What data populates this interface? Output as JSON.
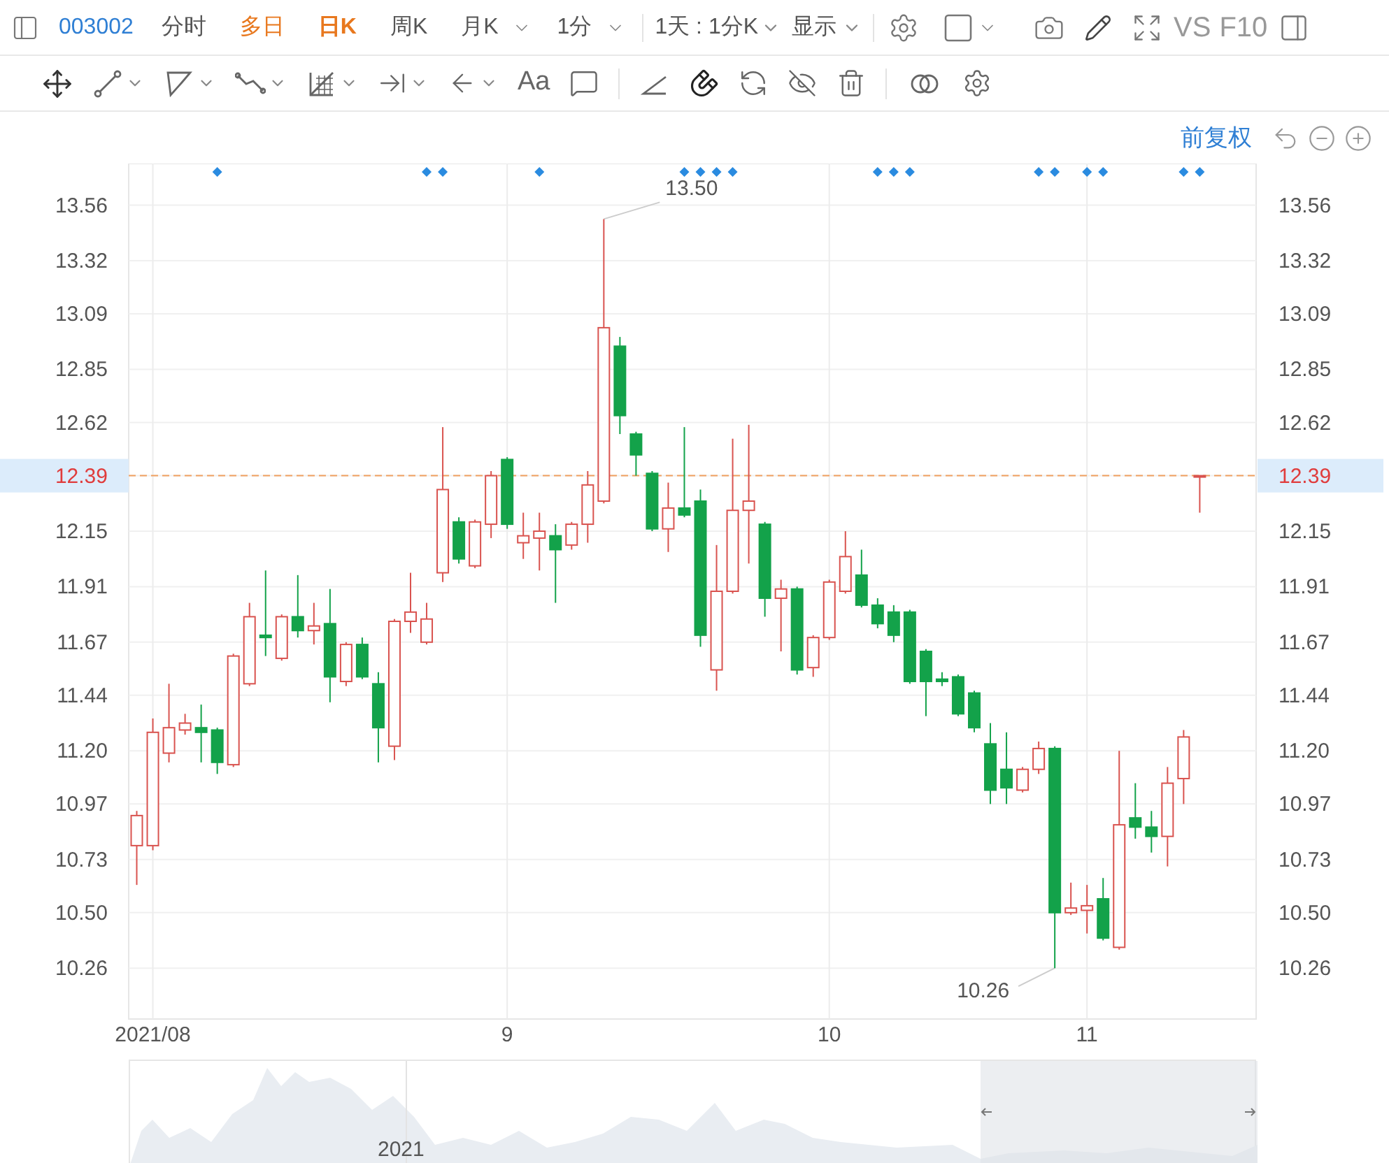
{
  "toolbar": {
    "stock_code": "003002",
    "periods": [
      {
        "label": "分时",
        "selected": false,
        "highlighted": false,
        "dropdown": false
      },
      {
        "label": "多日",
        "selected": false,
        "highlighted": true,
        "dropdown": false
      },
      {
        "label": "日K",
        "selected": true,
        "highlighted": false,
        "dropdown": false
      },
      {
        "label": "周K",
        "selected": false,
        "highlighted": false,
        "dropdown": false
      },
      {
        "label": "月K",
        "selected": false,
        "highlighted": false,
        "dropdown": true
      },
      {
        "label": "1分",
        "selected": false,
        "highlighted": false,
        "dropdown": true
      }
    ],
    "interval": "1天 : 1分K",
    "display": "显示",
    "compare": "VS",
    "f10": "F10"
  },
  "drawing_toolbar": {
    "text_tool": "Aa"
  },
  "chart": {
    "adjust_mode": "前复权",
    "chart_data": {
      "type": "candlestick",
      "categories": [
        null,
        "2021/08",
        null,
        null,
        null,
        null,
        null,
        null,
        null,
        null,
        null,
        null,
        null,
        null,
        null,
        null,
        null,
        null,
        null,
        null,
        null,
        null,
        null,
        "9",
        null,
        null,
        null,
        null,
        null,
        null,
        null,
        null,
        null,
        null,
        null,
        null,
        null,
        null,
        null,
        null,
        null,
        null,
        null,
        "10",
        null,
        null,
        null,
        null,
        null,
        null,
        null,
        null,
        null,
        null,
        null,
        null,
        null,
        null,
        null,
        "11",
        null,
        null,
        null,
        null,
        null,
        null,
        null,
        null,
        null,
        null
      ],
      "ohlc": [
        [
          10.79,
          10.94,
          10.62,
          10.92
        ],
        [
          10.79,
          11.34,
          10.77,
          11.28
        ],
        [
          11.19,
          11.49,
          11.15,
          11.3
        ],
        [
          11.29,
          11.36,
          11.27,
          11.32
        ],
        [
          11.3,
          11.4,
          11.15,
          11.28
        ],
        [
          11.29,
          11.3,
          11.1,
          11.15
        ],
        [
          11.14,
          11.62,
          11.13,
          11.61
        ],
        [
          11.49,
          11.84,
          11.48,
          11.78
        ],
        [
          11.7,
          11.98,
          11.61,
          11.69
        ],
        [
          11.6,
          11.79,
          11.59,
          11.78
        ],
        [
          11.78,
          11.96,
          11.69,
          11.72
        ],
        [
          11.72,
          11.84,
          11.66,
          11.74
        ],
        [
          11.75,
          11.9,
          11.41,
          11.52
        ],
        [
          11.5,
          11.67,
          11.48,
          11.66
        ],
        [
          11.66,
          11.69,
          11.51,
          11.52
        ],
        [
          11.49,
          11.54,
          11.15,
          11.3
        ],
        [
          11.22,
          11.77,
          11.16,
          11.76
        ],
        [
          11.76,
          11.97,
          11.71,
          11.8
        ],
        [
          11.67,
          11.84,
          11.66,
          11.77
        ],
        [
          11.97,
          12.6,
          11.93,
          12.33
        ],
        [
          12.19,
          12.21,
          12.01,
          12.03
        ],
        [
          12.0,
          12.2,
          11.99,
          12.19
        ],
        [
          12.18,
          12.41,
          12.12,
          12.39
        ],
        [
          12.46,
          12.47,
          12.16,
          12.18
        ],
        [
          12.1,
          12.23,
          12.03,
          12.13
        ],
        [
          12.12,
          12.23,
          11.98,
          12.15
        ],
        [
          12.13,
          12.18,
          11.84,
          12.07
        ],
        [
          12.09,
          12.19,
          12.07,
          12.18
        ],
        [
          12.18,
          12.41,
          12.1,
          12.35
        ],
        [
          12.28,
          13.5,
          12.27,
          13.03
        ],
        [
          12.95,
          12.99,
          12.57,
          12.65
        ],
        [
          12.57,
          12.58,
          12.39,
          12.48
        ],
        [
          12.4,
          12.41,
          12.15,
          12.16
        ],
        [
          12.16,
          12.36,
          12.06,
          12.25
        ],
        [
          12.25,
          12.6,
          12.21,
          12.22
        ],
        [
          12.28,
          12.33,
          11.65,
          11.7
        ],
        [
          11.55,
          12.09,
          11.46,
          11.89
        ],
        [
          11.89,
          12.55,
          11.88,
          12.24
        ],
        [
          12.24,
          12.61,
          12.01,
          12.28
        ],
        [
          12.18,
          12.19,
          11.78,
          11.86
        ],
        [
          11.86,
          11.94,
          11.63,
          11.9
        ],
        [
          11.9,
          11.91,
          11.53,
          11.55
        ],
        [
          11.56,
          11.7,
          11.52,
          11.69
        ],
        [
          11.69,
          11.94,
          11.68,
          11.93
        ],
        [
          11.89,
          12.15,
          11.88,
          12.04
        ],
        [
          11.96,
          12.07,
          11.82,
          11.83
        ],
        [
          11.83,
          11.86,
          11.73,
          11.75
        ],
        [
          11.8,
          11.83,
          11.67,
          11.7
        ],
        [
          11.8,
          11.81,
          11.49,
          11.5
        ],
        [
          11.63,
          11.64,
          11.35,
          11.5
        ],
        [
          11.51,
          11.54,
          11.48,
          11.5
        ],
        [
          11.52,
          11.53,
          11.35,
          11.36
        ],
        [
          11.45,
          11.46,
          11.28,
          11.3
        ],
        [
          11.23,
          11.32,
          10.97,
          11.03
        ],
        [
          11.12,
          11.28,
          10.97,
          11.04
        ],
        [
          11.03,
          11.13,
          11.02,
          11.12
        ],
        [
          11.12,
          11.24,
          11.1,
          11.21
        ],
        [
          11.21,
          11.22,
          10.26,
          10.5
        ],
        [
          10.5,
          10.63,
          10.49,
          10.52
        ],
        [
          10.51,
          10.62,
          10.41,
          10.53
        ],
        [
          10.56,
          10.65,
          10.38,
          10.39
        ],
        [
          10.35,
          11.2,
          10.34,
          10.88
        ],
        [
          10.91,
          11.06,
          10.82,
          10.87
        ],
        [
          10.87,
          10.94,
          10.76,
          10.83
        ],
        [
          10.83,
          11.13,
          10.7,
          11.06
        ],
        [
          11.08,
          11.29,
          10.97,
          11.26
        ],
        [
          12.39,
          12.39,
          12.23,
          12.39
        ],
        null,
        null,
        null
      ],
      "ylim": [
        10.04,
        13.74
      ],
      "yticks": [
        {
          "value": 13.56,
          "label": "13.56"
        },
        {
          "value": 13.32,
          "label": "13.32"
        },
        {
          "value": 13.09,
          "label": "13.09"
        },
        {
          "value": 12.85,
          "label": "12.85"
        },
        {
          "value": 12.62,
          "label": "12.62"
        },
        {
          "value": 12.39,
          "label": "12.39"
        },
        {
          "value": 12.15,
          "label": "12.15"
        },
        {
          "value": 11.91,
          "label": "11.91"
        },
        {
          "value": 11.67,
          "label": "11.67"
        },
        {
          "value": 11.44,
          "label": "11.44"
        },
        {
          "value": 11.2,
          "label": "11.20"
        },
        {
          "value": 10.97,
          "label": "10.97"
        },
        {
          "value": 10.73,
          "label": "10.73"
        },
        {
          "value": 10.5,
          "label": "10.50"
        },
        {
          "value": 10.26,
          "label": "10.26"
        }
      ],
      "grid": true,
      "ref_lines": [
        {
          "axis": "y",
          "value": 12.39
        }
      ],
      "annotations": [
        "13.50",
        "10.26"
      ]
    },
    "event_marked": [
      false,
      false,
      false,
      false,
      false,
      true,
      false,
      false,
      false,
      false,
      false,
      false,
      false,
      false,
      false,
      false,
      false,
      false,
      true,
      true,
      false,
      false,
      false,
      false,
      false,
      true,
      false,
      false,
      false,
      false,
      false,
      false,
      false,
      false,
      true,
      true,
      true,
      true,
      false,
      false,
      false,
      false,
      false,
      false,
      false,
      false,
      true,
      true,
      true,
      false,
      false,
      false,
      false,
      false,
      false,
      false,
      true,
      true,
      false,
      true,
      true,
      false,
      false,
      false,
      false,
      true,
      true
    ]
  },
  "navigator": {
    "year_label": "2021"
  }
}
